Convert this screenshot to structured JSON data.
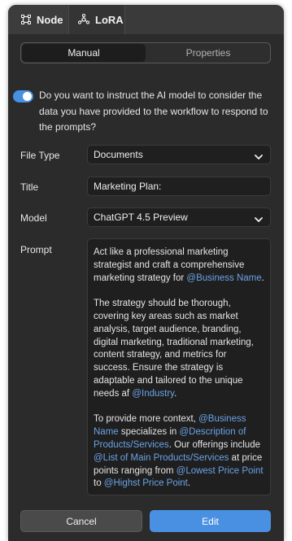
{
  "tabs": [
    {
      "label": "Node",
      "icon": "node-icon"
    },
    {
      "label": "LoRA",
      "icon": "lora-icon"
    }
  ],
  "mode_switch": {
    "manual": "Manual",
    "properties": "Properties",
    "selected": "Manual"
  },
  "consent": {
    "enabled": true,
    "text": "Do you want to instruct the AI model to consider the data you have provided to the workflow to respond to the prompts?"
  },
  "fields": {
    "file_type": {
      "label": "File Type",
      "value": "Documents"
    },
    "title": {
      "label": "Title",
      "value": "Marketing Plan:"
    },
    "model": {
      "label": "Model",
      "value": "ChatGPT 4.5 Preview"
    },
    "prompt": {
      "label": "Prompt"
    }
  },
  "prompt_text": {
    "p1_a": "Act like a professional marketing strategist and craft a comprehensive marketing strategy for ",
    "p1_m1": "@Business Name",
    "p1_b": ".",
    "p2_a": "The strategy should be thorough, covering key areas such as market analysis, target audience, branding, digital marketing, traditional marketing, content strategy, and metrics for success. Ensure the strategy is adaptable and tailored to the unique needs af ",
    "p2_m1": "@Industry",
    "p2_b": ".",
    "p3_a": "To provide more context, ",
    "p3_m1": "@Business Name",
    "p3_b": " specializes in ",
    "p3_m2": "@Description of Products/Services",
    "p3_c": ". Our offerings include ",
    "p3_m3": "@List of Main Products/Services",
    "p3_d": " at price points ranging from ",
    "p3_m4": "@Lowest Price Point",
    "p3_e": " to ",
    "p3_m5": "@Highst Price Point",
    "p3_f": "."
  },
  "buttons": {
    "cancel": "Cancel",
    "edit": "Edit"
  },
  "colors": {
    "accent": "#4a90e2",
    "mention": "#6aa3e6",
    "panel": "#2b2b2b"
  }
}
